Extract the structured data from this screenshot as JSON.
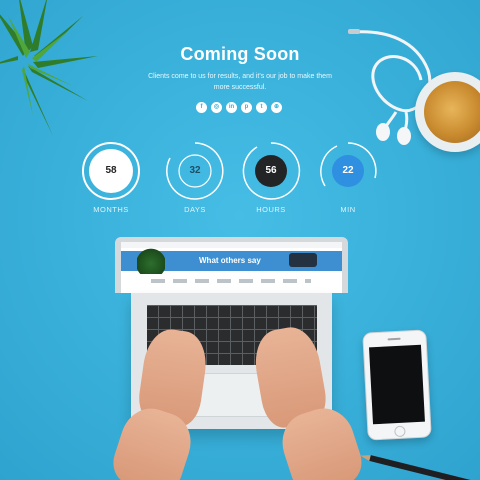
{
  "hero": {
    "title": "Coming Soon",
    "subtitle": "Clients come to us for results, and it's our job to make them more successful."
  },
  "social": [
    {
      "icon": "facebook-icon",
      "glyph": "f"
    },
    {
      "icon": "instagram-icon",
      "glyph": "◎"
    },
    {
      "icon": "linkedin-icon",
      "glyph": "in"
    },
    {
      "icon": "pinterest-icon",
      "glyph": "p"
    },
    {
      "icon": "twitter-icon",
      "glyph": "t"
    },
    {
      "icon": "dribbble-icon",
      "glyph": "⊕"
    }
  ],
  "countdown": [
    {
      "value": "58",
      "label": "MONTHS",
      "style": "filled",
      "progress": 0.97
    },
    {
      "value": "32",
      "label": "DAYS",
      "style": "outline",
      "progress": 0.75
    },
    {
      "value": "56",
      "label": "HOURS",
      "style": "dark",
      "progress": 0.92
    },
    {
      "value": "22",
      "label": "MIN",
      "style": "accent",
      "progress": 0.6
    }
  ],
  "laptop_screen": {
    "heading": "What others say"
  },
  "colors": {
    "background": "#39b1da",
    "accent": "#2f8fe0",
    "dark": "#222426",
    "white": "#ffffff"
  }
}
